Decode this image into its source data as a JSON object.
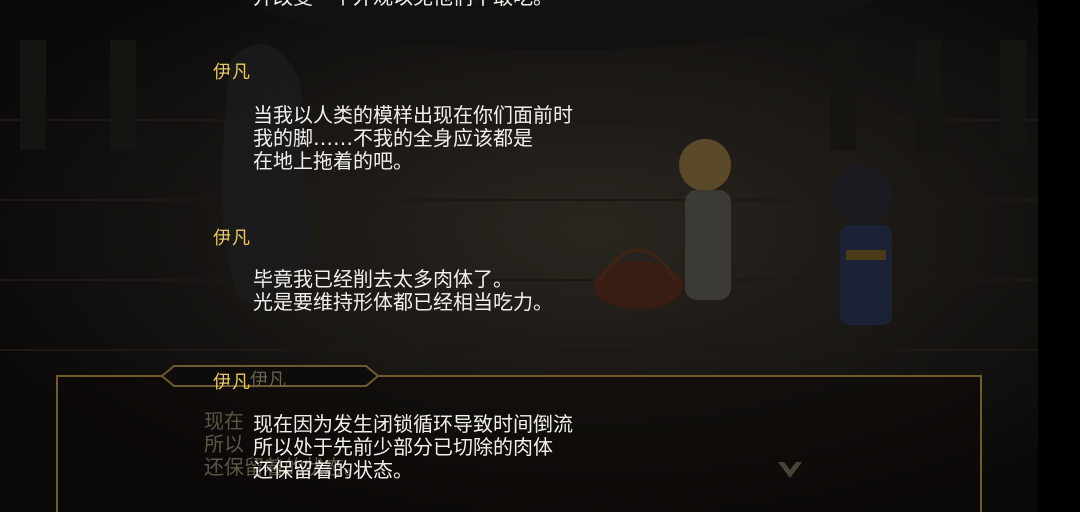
{
  "top_fragment": "并改变一个外观以免他们不敢吃。",
  "backlog": [
    {
      "speaker": "伊凡",
      "lines": [
        "当我以人类的模样出现在你们面前时",
        "我的脚……不我的全身应该都是",
        "在地上拖着的吧。"
      ]
    },
    {
      "speaker": "伊凡",
      "lines": [
        "毕竟我已经削去太多肉体了。",
        "光是要维持形体都已经相当吃力。"
      ]
    },
    {
      "speaker": "伊凡",
      "lines": [
        "现在因为发生闭锁循环导致时间倒流",
        "所以处于先前少部分已切除的肉体",
        "还保留着的状态。"
      ]
    }
  ],
  "dialog": {
    "speaker": "伊凡",
    "lines": [
      "现在",
      "所以",
      "还保留着的状态。"
    ]
  },
  "colors": {
    "speaker": "#e9c867",
    "text": "#f2f0ea",
    "frame": "#6e5a2d"
  },
  "icons": {
    "advance": "chevron-down-ornament-icon"
  }
}
